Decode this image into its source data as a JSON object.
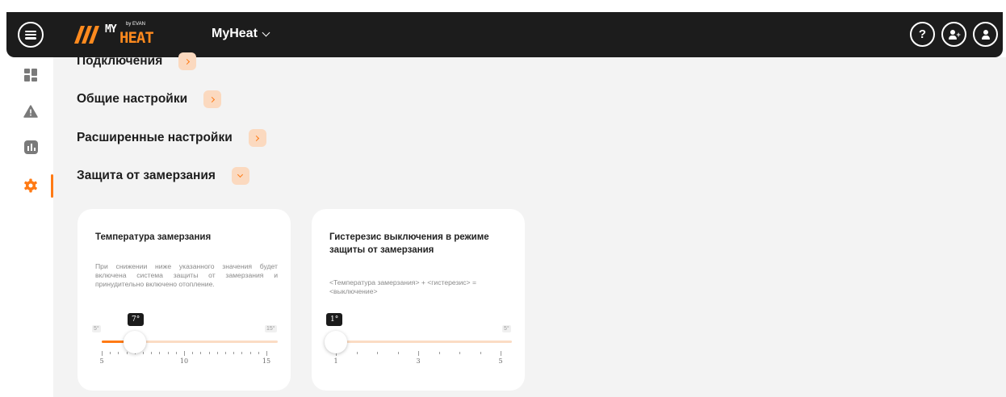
{
  "header": {
    "logo": {
      "my": "MY",
      "by": "by EVAN",
      "heat": "HEAT"
    },
    "app_title": "MyHeat",
    "help_label": "?"
  },
  "sections": [
    {
      "label": "Подключения",
      "state": "collapsed"
    },
    {
      "label": "Общие настройки",
      "state": "collapsed"
    },
    {
      "label": "Расширенные настройки",
      "state": "collapsed"
    },
    {
      "label": "Защита от замерзания",
      "state": "expanded"
    }
  ],
  "freeze_temp": {
    "title": "Температура замерзания",
    "description": "При снижении ниже указанного значения будет включена система защиты от замерзания и принудительно включено отопление.",
    "min_chip": "5°",
    "max_chip": "15°",
    "value_label": "7°",
    "value": 7,
    "min": 5,
    "max": 15,
    "tick_labels": [
      "5",
      "10",
      "15"
    ]
  },
  "hysteresis": {
    "title": "Гистерезис выключения в режиме защиты от замерзания",
    "description": "<Температура замерзания> + <гистерезис> = <выключение>",
    "max_chip": "5°",
    "value_label": "1°",
    "value": 1,
    "min": 1,
    "max": 5,
    "tick_labels": [
      "1",
      "3",
      "5"
    ]
  },
  "colors": {
    "accent": "#ff7a14",
    "accent_light": "#fbd9bf",
    "topbar": "#1c1c1c"
  },
  "icons": {
    "sidebar": [
      "dashboard-icon",
      "warning-icon",
      "chart-icon",
      "settings-icon"
    ],
    "top": [
      "help-icon",
      "add-user-icon",
      "user-icon"
    ]
  }
}
